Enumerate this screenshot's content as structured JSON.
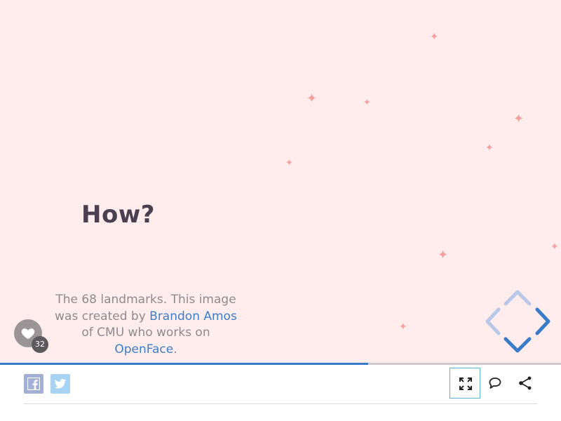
{
  "slide": {
    "title": "How?",
    "caption": {
      "text_before": "The 68 landmarks. This image was created by ",
      "author_link": "Brandon Amos",
      "text_middle": " of CMU who works on ",
      "project_link": "OpenFace",
      "text_after": "."
    },
    "background_color": "#ffeced",
    "sparkle_color": "#f2a19f"
  },
  "likes": {
    "icon": "heart-icon",
    "count": "32"
  },
  "navigation": {
    "icons": [
      "nav-up-icon",
      "nav-left-icon",
      "nav-right-icon",
      "nav-down-icon"
    ],
    "active_color": "#3a7bc8",
    "inactive_color": "#b8c8e6"
  },
  "progress": {
    "fraction": 0.656,
    "color": "#3a7bc8"
  },
  "toolbar": {
    "share_facebook_icon": "facebook-icon",
    "share_twitter_icon": "twitter-icon",
    "fullscreen_icon": "fullscreen-icon",
    "comment_icon": "comment-icon",
    "share_icon": "share-icon"
  }
}
